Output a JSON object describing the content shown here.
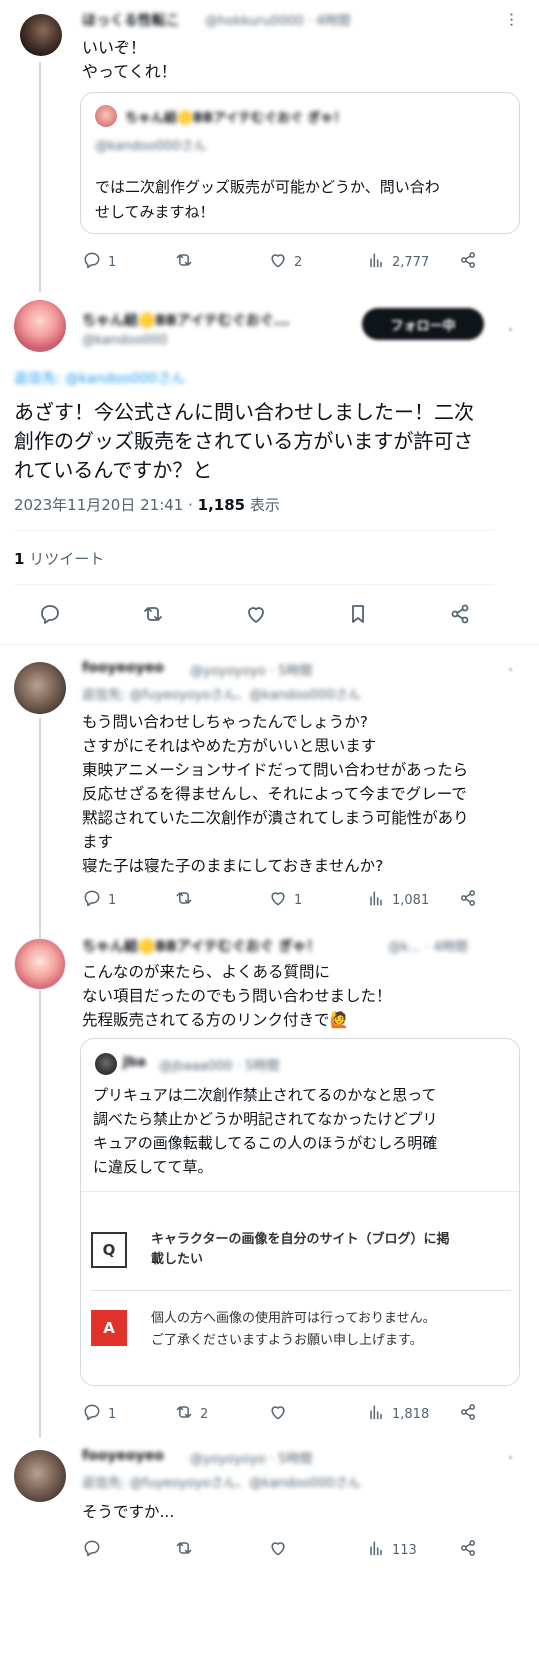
{
  "post1": {
    "author": "ほっくる性転こ",
    "handle": "@hokkuru0000 · 4時間",
    "text": "いいぞ！\nやってくれ！",
    "quote": {
      "author": "ちゃん結🟡BBアイテむぐおぐ ぎゃ！",
      "handle": "@kandoo000さん",
      "text": "では二次創作グッズ販売が可能かどうか、問い合わ\nせしてみますね！"
    },
    "stats": {
      "replies": "1",
      "reposts": "",
      "likes": "2",
      "views": "2,777"
    }
  },
  "main": {
    "author": "ちゃん結🟡BBアイテむぐおぐ...",
    "handle": "@kandoo000",
    "follow_label": "フォロー中",
    "reply_to": "返信先: @kandoo000さん",
    "text": "あざす！今公式さんに問い合わせしましたー！二次\n創作のグッズ販売をされている方がいますが許可さ\nれているんですか？と",
    "date": "2023年11月20日 21:41",
    "dot": " · ",
    "views_count": "1,185",
    "views_label": " 表示",
    "repost_count": "1",
    "repost_label": " リツイート"
  },
  "reply1": {
    "author": "fooyeoyeo",
    "handle": "@yoyoyoyo · 5時間",
    "reply_to": "返信先: @fuyeoyoyoさん、@kandoo000さん",
    "text": "もう問い合わせしちゃったんでしょうか?\nさすがにそれはやめた方がいいと思います\n東映アニメーションサイドだって問い合わせがあったら\n反応せざるを得ませんし、それによって今までグレーで\n黙認されていた二次創作が潰されてしまう可能性があり\nます\n寝た子は寝た子のままにしておきませんか?",
    "stats": {
      "replies": "1",
      "reposts": "",
      "likes": "1",
      "views": "1,081"
    }
  },
  "reply2": {
    "author": "ちゃん結🟡BBアイテむぐおぐ ぎゃ！",
    "handle": "@k... · 4時間",
    "text": "こんなのが来たら、よくある質問に\nない項目だったのでもう問い合わせました！\n先程販売されてる方のリンク付きで🙋",
    "quote": {
      "author": "Jba",
      "handle": "@jbaaa000 · 5時間",
      "text": "プリキュアは二次創作禁止されてるのかなと思って\n調べたら禁止かどうか明記されてなかったけどプリ\nキュアの画像転載してるこの人のほうがむしろ明確\nに違反してて草。",
      "q_label": "Q",
      "q_text": "キャラクターの画像を自分のサイト（ブログ）に掲\n載したい",
      "a_label": "A",
      "a_text": "個人の方へ画像の使用許可は行っておりません。\nご了承くださいますようお願い申し上げます。"
    },
    "stats": {
      "replies": "1",
      "reposts": "2",
      "likes": "",
      "views": "1,818"
    }
  },
  "reply3": {
    "author": "fooyeoyeo",
    "handle": "@yoyoyoyo · 5時間",
    "reply_to": "返信先: @fuyeoyoyoさん、@kandoo000さん",
    "text": "そうですか...",
    "stats": {
      "replies": "",
      "reposts": "",
      "likes": "",
      "views": "113"
    }
  },
  "colors": {
    "accent": "#1d9bf0",
    "text": "#0f1419",
    "muted": "#536471",
    "line": "#cfd9de",
    "a_red": "#e0322b"
  }
}
